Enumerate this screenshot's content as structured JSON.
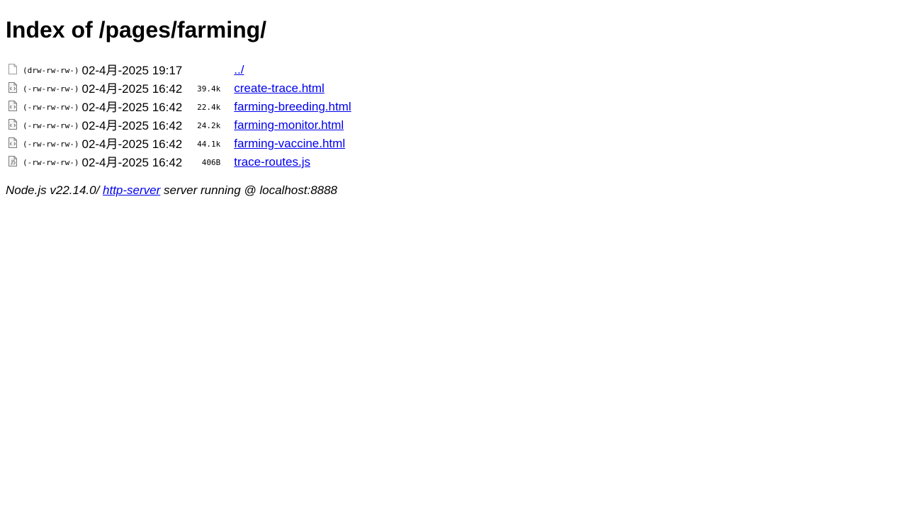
{
  "page": {
    "title": "Index of /pages/farming/"
  },
  "listing": {
    "entries": [
      {
        "icon": "folder-icon",
        "perms": "(drw-rw-rw-)",
        "date": "02-4月-2025 19:17",
        "size": "",
        "name": "../"
      },
      {
        "icon": "html-file-icon",
        "perms": "(-rw-rw-rw-)",
        "date": "02-4月-2025 16:42",
        "size": "39.4k",
        "name": "create-trace.html"
      },
      {
        "icon": "html-file-icon",
        "perms": "(-rw-rw-rw-)",
        "date": "02-4月-2025 16:42",
        "size": "22.4k",
        "name": "farming-breeding.html"
      },
      {
        "icon": "html-file-icon",
        "perms": "(-rw-rw-rw-)",
        "date": "02-4月-2025 16:42",
        "size": "24.2k",
        "name": "farming-monitor.html"
      },
      {
        "icon": "html-file-icon",
        "perms": "(-rw-rw-rw-)",
        "date": "02-4月-2025 16:42",
        "size": "44.1k",
        "name": "farming-vaccine.html"
      },
      {
        "icon": "js-file-icon",
        "perms": "(-rw-rw-rw-)",
        "date": "02-4月-2025 16:42",
        "size": "406B",
        "name": "trace-routes.js"
      }
    ]
  },
  "footer": {
    "prefix": "Node.js v22.14.0/ ",
    "link_label": "http-server",
    "suffix": " server running @ localhost:8888"
  }
}
